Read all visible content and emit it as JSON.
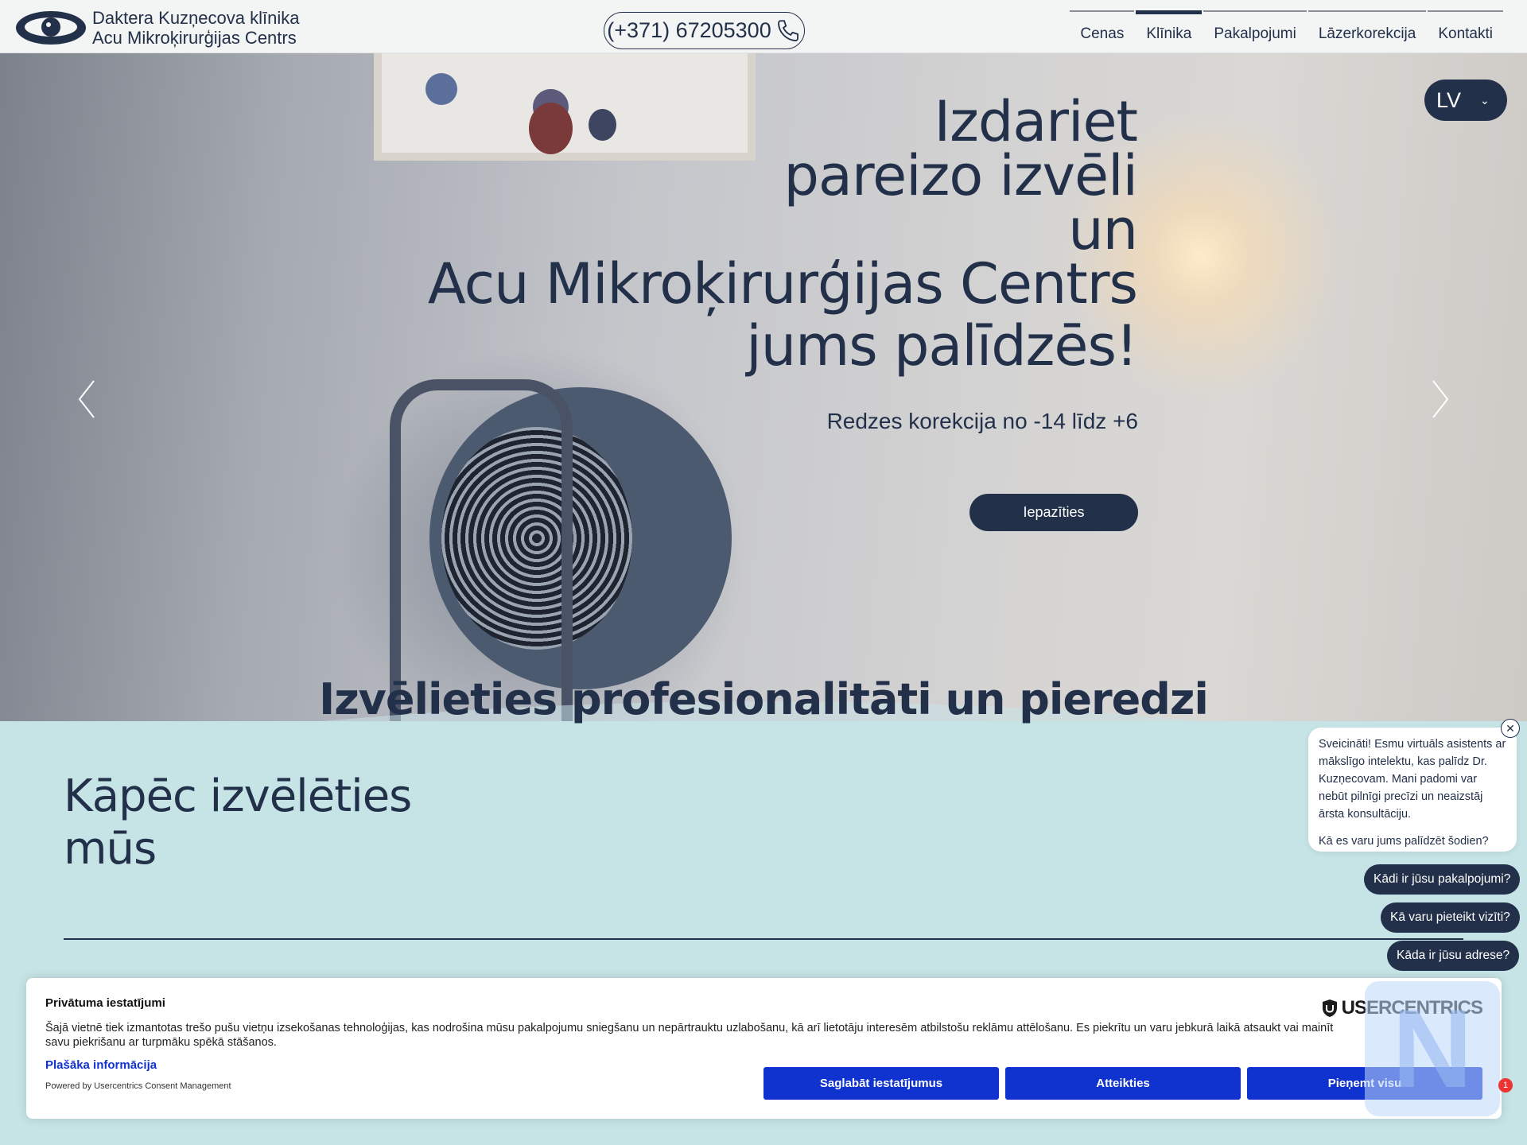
{
  "header": {
    "logo_line1": "Daktera Kuzņecova klīnika",
    "logo_line2": "Acu Mikroķirurģijas Centrs",
    "phone": "(+371) 67205300",
    "nav": [
      {
        "label": "Cenas",
        "active": false
      },
      {
        "label": "Klīnika",
        "active": true
      },
      {
        "label": "Pakalpojumi",
        "active": false
      },
      {
        "label": "Lāzerkorekcija",
        "active": false
      },
      {
        "label": "Kontakti",
        "active": false
      }
    ]
  },
  "hero": {
    "title_lines": [
      "Izdariet",
      "pareizo izvēli",
      "un",
      "Acu Mikroķirurģijas Centrs",
      "jums palīdzēs!"
    ],
    "subtitle": "Redzes korekcija no -14 līdz +6",
    "button": "Iepazīties",
    "language": "LV"
  },
  "section": {
    "title": "Izvēlieties profesionalitāti un pieredzi",
    "why_line1": "Kāpēc izvēlēties",
    "why_line2": "mūs"
  },
  "chat": {
    "message": "Sveicināti! Esmu virtuāls asistents ar mākslīgo intelektu, kas palīdz Dr. Kuzņecovam. Mani padomi var nebūt pilnīgi precīzi un neaizstāj ārsta konsultāciju.",
    "question": "Kā es varu jums palīdzēt šodien?",
    "chips": [
      "Kādi ir jūsu pakalpojumi?",
      "Kā varu pieteikt vizīti?",
      "Kāda ir jūsu adrese?"
    ],
    "badge": "1"
  },
  "cookie": {
    "title": "Privātuma iestatījumi",
    "text": "Šajā vietnē tiek izmantotas trešo pušu vietņu izsekošanas tehnoloģijas, kas nodrošina mūsu pakalpojumu sniegšanu un nepārtrauktu uzlabošanu, kā arī lietotāju interesēm atbilstošu reklāmu attēlošanu. Es piekrītu un varu jebkurā laikā atsaukt vai mainīt savu piekrišanu ar turpmāku spēkā stāšanos.",
    "more": "Plašāka informācija",
    "powered": "Powered by Usercentrics Consent Management",
    "brand": "USERCENTRICS",
    "btn_save": "Saglabāt iestatījumus",
    "btn_deny": "Atteikties",
    "btn_accept": "Pieņemt visu"
  },
  "colors": {
    "navy": "#22304a",
    "section_bg": "#c6e4e6",
    "cookie_blue": "#1032cf"
  }
}
